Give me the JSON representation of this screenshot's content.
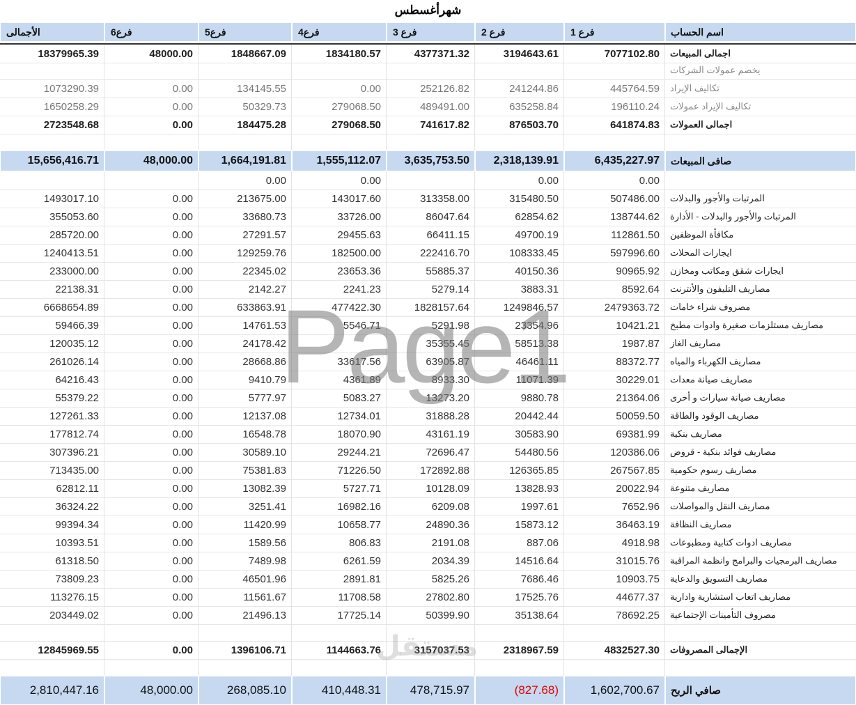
{
  "title": "شهرأغسطس",
  "headers": [
    "اسم  الحساب",
    "فرع 1",
    "فرع 2",
    "فرع 3",
    "فرع4",
    "فرع5",
    "فرع6",
    "الأجمالى"
  ],
  "rows": [
    {
      "type": "bold",
      "label": "اجمالى المبيعات",
      "values": [
        "7077102.80",
        "3194643.61",
        "4377371.32",
        "1834180.57",
        "1848667.09",
        "48000.00",
        "18379965.39"
      ]
    },
    {
      "type": "subhead",
      "label": "يخصم عمولات الشركات",
      "values": [
        "",
        "",
        "",
        "",
        "",
        "",
        ""
      ]
    },
    {
      "type": "sub",
      "label": "تكاليف الإيراد",
      "values": [
        "445764.59",
        "241244.86",
        "252126.82",
        "0.00",
        "134145.55",
        "0.00",
        "1073290.39"
      ]
    },
    {
      "type": "sub",
      "label": "تكاليف الإيراد عمولات",
      "values": [
        "196110.24",
        "635258.84",
        "489491.00",
        "279068.50",
        "50329.73",
        "0.00",
        "1650258.29"
      ]
    },
    {
      "type": "bold",
      "label": "اجمالى العمولات",
      "values": [
        "641874.83",
        "876503.70",
        "741617.82",
        "279068.50",
        "184475.28",
        "0.00",
        "2723548.68"
      ]
    },
    {
      "type": "blank",
      "label": "",
      "values": [
        "",
        "",
        "",
        "",
        "",
        "",
        ""
      ]
    },
    {
      "type": "total",
      "label": "صافى المبيعات",
      "values": [
        "6,435,227.97",
        "2,318,139.91",
        "3,635,753.50",
        "1,555,112.07",
        "1,664,191.81",
        "48,000.00",
        "15,656,416.71"
      ]
    },
    {
      "type": "data",
      "label": "",
      "values": [
        "0.00",
        "0.00",
        "",
        "0.00",
        "0.00",
        "",
        ""
      ]
    },
    {
      "type": "data",
      "label": "المرتبات والأجور  والبدلات",
      "values": [
        "507486.00",
        "315480.50",
        "313358.00",
        "143017.60",
        "213675.00",
        "0.00",
        "1493017.10"
      ]
    },
    {
      "type": "data",
      "label": "المرتبات والأجور  والبدلات - الأدارة",
      "values": [
        "138744.62",
        "62854.62",
        "86047.64",
        "33726.00",
        "33680.73",
        "0.00",
        "355053.60"
      ]
    },
    {
      "type": "data",
      "label": "مكافأة الموظفين",
      "values": [
        "112861.50",
        "49700.19",
        "66411.15",
        "29455.63",
        "27291.57",
        "0.00",
        "285720.00"
      ]
    },
    {
      "type": "data",
      "label": "ايجارات المحلات",
      "values": [
        "597996.60",
        "108333.45",
        "222416.70",
        "182500.00",
        "129259.76",
        "0.00",
        "1240413.51"
      ]
    },
    {
      "type": "data",
      "label": "ايجارات شقق ومكاتب  ومخازن",
      "values": [
        "90965.92",
        "40150.36",
        "55885.37",
        "23653.36",
        "22345.02",
        "0.00",
        "233000.00"
      ]
    },
    {
      "type": "data",
      "label": "مصاريف التليفون والأنترنت",
      "values": [
        "8592.64",
        "3883.31",
        "5279.14",
        "2241.23",
        "2142.27",
        "0.00",
        "22138.31"
      ]
    },
    {
      "type": "data",
      "label": "مصروف شراء خامات",
      "values": [
        "2479363.72",
        "1249846.57",
        "1828157.64",
        "477422.30",
        "633863.91",
        "0.00",
        "6668654.89"
      ]
    },
    {
      "type": "data",
      "label": "مصاريف مستلزمات صغيرة وادوات مطبخ",
      "values": [
        "10421.21",
        "23354.96",
        "5291.98",
        "5546.71",
        "14761.53",
        "0.00",
        "59466.39"
      ]
    },
    {
      "type": "data",
      "label": "مصاريف الغاز",
      "values": [
        "1987.87",
        "58513.38",
        "35355.45",
        "",
        "24178.42",
        "0.00",
        "120035.12"
      ]
    },
    {
      "type": "data",
      "label": "مصاريف الكهرباء والمياه",
      "values": [
        "88372.77",
        "46461.11",
        "63905.87",
        "33617.56",
        "28668.86",
        "0.00",
        "261026.14"
      ]
    },
    {
      "type": "data",
      "label": "مصاريف صيانة معدات",
      "values": [
        "30229.01",
        "11071.39",
        "8933.30",
        "4361.89",
        "9410.79",
        "0.00",
        "64216.43"
      ]
    },
    {
      "type": "data",
      "label": "مصاريف صيانة سيارات و أخرى",
      "values": [
        "21364.06",
        "9880.78",
        "13273.20",
        "5083.27",
        "5777.97",
        "0.00",
        "55379.22"
      ]
    },
    {
      "type": "data",
      "label": "مصاريف الوقود والطاقة",
      "values": [
        "50059.50",
        "20442.44",
        "31888.28",
        "12734.01",
        "12137.08",
        "0.00",
        "127261.33"
      ]
    },
    {
      "type": "data",
      "label": "مصاريف بنكية",
      "values": [
        "69381.99",
        "30583.90",
        "43161.19",
        "18070.90",
        "16548.78",
        "0.00",
        "177812.74"
      ]
    },
    {
      "type": "data",
      "label": "مصاريف فوائد بنكية - قروض",
      "values": [
        "120386.06",
        "54480.56",
        "72696.47",
        "29244.21",
        "30589.10",
        "0.00",
        "307396.21"
      ]
    },
    {
      "type": "data",
      "label": "مصاريف رسوم حكومية",
      "values": [
        "267567.85",
        "126365.85",
        "172892.88",
        "71226.50",
        "75381.83",
        "0.00",
        "713435.00"
      ]
    },
    {
      "type": "data",
      "label": "مصاريف متنوعة",
      "values": [
        "20022.94",
        "13828.93",
        "10128.09",
        "5727.71",
        "13082.39",
        "0.00",
        "62812.11"
      ]
    },
    {
      "type": "data",
      "label": "مصاريف النقل والمواصلات",
      "values": [
        "7652.96",
        "1997.61",
        "6209.08",
        "16982.16",
        "3251.41",
        "0.00",
        "36324.22"
      ]
    },
    {
      "type": "data",
      "label": "مصاريف النظافة",
      "values": [
        "36463.19",
        "15873.12",
        "24890.36",
        "10658.77",
        "11420.99",
        "0.00",
        "99394.34"
      ]
    },
    {
      "type": "data",
      "label": "مصاريف ادوات كتابية ومطبوعات",
      "values": [
        "4918.98",
        "887.06",
        "2191.08",
        "806.83",
        "1589.56",
        "0.00",
        "10393.51"
      ]
    },
    {
      "type": "data",
      "label": "مصاريف البرمجيات والبرامج وانظمة المراقبة",
      "values": [
        "31015.76",
        "14516.64",
        "2034.39",
        "6261.59",
        "7489.98",
        "0.00",
        "61318.50"
      ]
    },
    {
      "type": "data",
      "label": "مصاريف التسويق والدعاية",
      "values": [
        "10903.75",
        "7686.46",
        "5825.26",
        "2891.81",
        "46501.96",
        "0.00",
        "73809.23"
      ]
    },
    {
      "type": "data",
      "label": "مصاريف اتعاب استشارية وادارية",
      "values": [
        "44677.37",
        "17525.76",
        "27802.80",
        "11708.58",
        "11561.67",
        "0.00",
        "113276.15"
      ]
    },
    {
      "type": "data",
      "label": "مصروف التأمينات الإجتماعية",
      "values": [
        "78692.25",
        "35138.64",
        "50399.90",
        "17725.14",
        "21496.13",
        "0.00",
        "203449.02"
      ]
    },
    {
      "type": "blank",
      "label": "",
      "values": [
        "",
        "",
        "",
        "",
        "",
        "",
        ""
      ]
    },
    {
      "type": "bold",
      "label": "الإجمالى المصروفات",
      "values": [
        "4832527.30",
        "2318967.59",
        "3157037.53",
        "1144663.76",
        "1396106.71",
        "0.00",
        "12845969.55"
      ]
    },
    {
      "type": "blank",
      "label": "",
      "values": [
        "",
        "",
        "",
        "",
        "",
        "",
        ""
      ]
    },
    {
      "type": "profit",
      "label": "صافي الربح",
      "values": [
        "1,602,700.67",
        "(827.68)",
        "478,715.97",
        "410,448.31",
        "268,085.10",
        "48,000.00",
        "2,810,447.16"
      ]
    }
  ],
  "watermark": "Page1",
  "logo_text": "مستقل",
  "colors": {
    "header_bg": "#c6d9f0",
    "negative": "#e00000",
    "watermark": "#787878"
  }
}
